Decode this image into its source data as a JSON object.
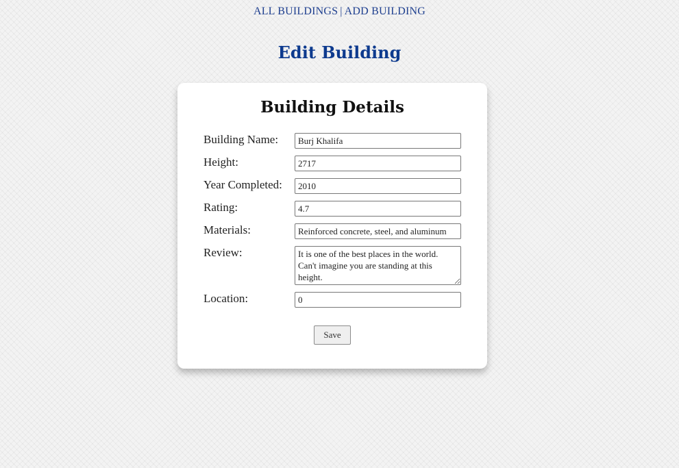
{
  "nav": {
    "all_buildings": "ALL BUILDINGS",
    "separator": "|",
    "add_building": "ADD BUILDING"
  },
  "page": {
    "title": "Edit Building"
  },
  "form": {
    "title": "Building Details",
    "fields": {
      "name": {
        "label": "Building Name:",
        "value": "Burj Khalifa"
      },
      "height": {
        "label": "Height:",
        "value": "2717"
      },
      "year": {
        "label": "Year Completed:",
        "value": "2010"
      },
      "rating": {
        "label": "Rating:",
        "value": "4.7"
      },
      "materials": {
        "label": "Materials:",
        "value": "Reinforced concrete, steel, and aluminum"
      },
      "review": {
        "label": "Review:",
        "value": "It is one of the best places in the world. Can't imagine you are standing at this height."
      },
      "location": {
        "label": "Location:",
        "value": "0"
      }
    },
    "save_label": "Save"
  },
  "colors": {
    "nav_link": "#1e3f8f",
    "page_title": "#0d3a8e",
    "card_background": "#ffffff"
  }
}
